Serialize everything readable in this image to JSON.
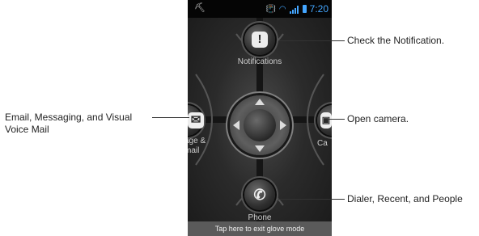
{
  "status_bar": {
    "left_icon": "usb-icon",
    "time": "7:20",
    "icons": [
      "vibrate-icon",
      "wifi-icon",
      "signal-icon",
      "battery-icon"
    ]
  },
  "glove_mode": {
    "top": {
      "label": "Notifications",
      "icon": "notification-icon"
    },
    "left": {
      "label": "age &\nmail",
      "icon": "message-icon"
    },
    "right": {
      "label": "Ca",
      "icon": "camera-icon"
    },
    "bottom": {
      "label": "Phone",
      "icon": "phone-icon"
    },
    "exit_bar": "Tap here to exit glove mode"
  },
  "callouts": {
    "notifications": "Check the Notification.",
    "messaging": "Email, Messaging, and Visual Voice Mail",
    "camera": "Open camera.",
    "phone": "Dialer, Recent, and People"
  },
  "colors": {
    "accent": "#44a6ff"
  }
}
